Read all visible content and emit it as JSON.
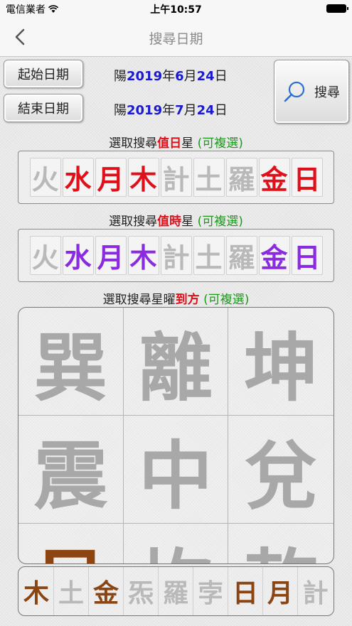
{
  "status_bar": {
    "carrier": "電信業者",
    "time": "上午10:57"
  },
  "nav": {
    "title": "搜尋日期"
  },
  "dates": {
    "start_button": "起始日期",
    "end_button": "結束日期",
    "start": {
      "prefix": "陽",
      "year": "2019",
      "y": "年",
      "month": "6",
      "m": "月",
      "day": "24",
      "d": "日"
    },
    "end": {
      "prefix": "陽",
      "year": "2019",
      "y": "年",
      "month": "7",
      "m": "月",
      "day": "24",
      "d": "日"
    },
    "search_button": "搜尋"
  },
  "day_star": {
    "title_a": "選取搜尋",
    "title_red": "值日",
    "title_b": "星 ",
    "title_green": "(可複選)",
    "items": [
      {
        "label": "火",
        "color": "#b9b9b9"
      },
      {
        "label": "水",
        "color": "#e0101a"
      },
      {
        "label": "月",
        "color": "#e0101a"
      },
      {
        "label": "木",
        "color": "#e0101a"
      },
      {
        "label": "計",
        "color": "#b9b9b9"
      },
      {
        "label": "土",
        "color": "#b9b9b9"
      },
      {
        "label": "羅",
        "color": "#b9b9b9"
      },
      {
        "label": "金",
        "color": "#e0101a"
      },
      {
        "label": "日",
        "color": "#e0101a"
      }
    ]
  },
  "hour_star": {
    "title_a": "選取搜尋",
    "title_red": "值時",
    "title_b": "星 ",
    "title_green": "(可複選)",
    "items": [
      {
        "label": "火",
        "color": "#b9b9b9"
      },
      {
        "label": "水",
        "color": "#8a2be2"
      },
      {
        "label": "月",
        "color": "#8a2be2"
      },
      {
        "label": "木",
        "color": "#8a2be2"
      },
      {
        "label": "計",
        "color": "#b9b9b9"
      },
      {
        "label": "土",
        "color": "#b9b9b9"
      },
      {
        "label": "羅",
        "color": "#b9b9b9"
      },
      {
        "label": "金",
        "color": "#8a2be2"
      },
      {
        "label": "日",
        "color": "#8a2be2"
      }
    ]
  },
  "direction": {
    "title_a": "選取搜尋星曜",
    "title_red": "到方",
    "title_b": " ",
    "title_green": "(可複選)",
    "cells": [
      {
        "label": "巽",
        "color": "#a8a8a8"
      },
      {
        "label": "離",
        "color": "#a8a8a8"
      },
      {
        "label": "坤",
        "color": "#a8a8a8"
      },
      {
        "label": "震",
        "color": "#a8a8a8"
      },
      {
        "label": "中",
        "color": "#a8a8a8"
      },
      {
        "label": "兌",
        "color": "#a8a8a8"
      },
      {
        "label": "艮",
        "color": "#8b4513"
      },
      {
        "label": "坎",
        "color": "#a8a8a8"
      },
      {
        "label": "乾",
        "color": "#a8a8a8"
      }
    ]
  },
  "planets": {
    "items": [
      {
        "label": "木",
        "color": "#8b4513"
      },
      {
        "label": "土",
        "color": "#b9b9b9"
      },
      {
        "label": "金",
        "color": "#8b4513"
      },
      {
        "label": "炁",
        "color": "#b9b9b9"
      },
      {
        "label": "羅",
        "color": "#b9b9b9"
      },
      {
        "label": "孛",
        "color": "#b9b9b9"
      },
      {
        "label": "日",
        "color": "#8b4513"
      },
      {
        "label": "月",
        "color": "#8b4513"
      },
      {
        "label": "計",
        "color": "#b9b9b9"
      }
    ]
  }
}
